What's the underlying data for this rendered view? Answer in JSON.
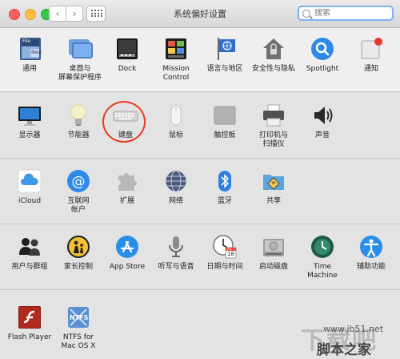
{
  "window": {
    "title": "系统偏好设置",
    "search_placeholder": "搜索"
  },
  "rows": [
    {
      "items": [
        {
          "id": "general",
          "label": "通用"
        },
        {
          "id": "desktop",
          "label": "桌面与\n屏幕保护程序"
        },
        {
          "id": "dock",
          "label": "Dock"
        },
        {
          "id": "mission",
          "label": "Mission\nControl"
        },
        {
          "id": "language",
          "label": "语言与地区"
        },
        {
          "id": "security",
          "label": "安全性与隐私"
        },
        {
          "id": "spotlight",
          "label": "Spotlight"
        },
        {
          "id": "notifications",
          "label": "通知"
        }
      ]
    },
    {
      "items": [
        {
          "id": "displays",
          "label": "显示器"
        },
        {
          "id": "energy",
          "label": "节能器"
        },
        {
          "id": "keyboard",
          "label": "键盘"
        },
        {
          "id": "mouse",
          "label": "鼠标"
        },
        {
          "id": "trackpad",
          "label": "触控板"
        },
        {
          "id": "printers",
          "label": "打印机与\n扫描仪"
        },
        {
          "id": "sound",
          "label": "声音"
        }
      ]
    },
    {
      "items": [
        {
          "id": "icloud",
          "label": "iCloud"
        },
        {
          "id": "internet",
          "label": "互联网\n帐户"
        },
        {
          "id": "extensions",
          "label": "扩展"
        },
        {
          "id": "network",
          "label": "网络"
        },
        {
          "id": "bluetooth",
          "label": "蓝牙"
        },
        {
          "id": "sharing",
          "label": "共享"
        }
      ]
    },
    {
      "items": [
        {
          "id": "users",
          "label": "用户与群组"
        },
        {
          "id": "parental",
          "label": "家长控制"
        },
        {
          "id": "appstore",
          "label": "App Store"
        },
        {
          "id": "dictation",
          "label": "听写与语音"
        },
        {
          "id": "datetime",
          "label": "日期与时间"
        },
        {
          "id": "startup",
          "label": "启动磁盘"
        },
        {
          "id": "timemachine",
          "label": "Time Machine"
        },
        {
          "id": "accessibility",
          "label": "辅助功能"
        }
      ]
    },
    {
      "items": [
        {
          "id": "flash",
          "label": "Flash Player"
        },
        {
          "id": "ntfs",
          "label": "NTFS for\nMac OS X"
        }
      ]
    }
  ],
  "icon_texts": {
    "general_file": "File",
    "general_new": "New",
    "calendar_month": "JUL",
    "calendar_day": "18",
    "ntfs": "NTFS"
  },
  "watermark": {
    "logo": "下载吧",
    "site": "www.jb51.net",
    "slogan": "脚本之家"
  },
  "colors": {
    "highlight_circle": "#e83a20",
    "search_border": "#80b0f0"
  }
}
